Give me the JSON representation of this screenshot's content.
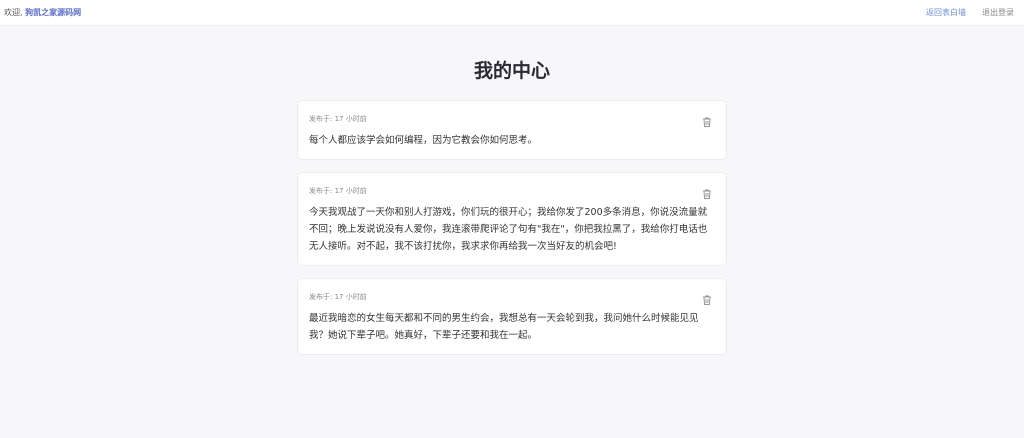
{
  "header": {
    "welcome_prefix": "欢迎,",
    "username": "狗凯之家源码网",
    "back_link": "返回表白墙",
    "logout_link": "退出登录"
  },
  "page_title": "我的中心",
  "posts": [
    {
      "meta": "发布于: 17 小时前",
      "content": "每个人都应该学会如何编程，因为它教会你如何思考。"
    },
    {
      "meta": "发布于: 17 小时前",
      "content": "今天我观战了一天你和别人打游戏，你们玩的很开心；我给你发了200多条消息，你说没流量就不回；晚上发说说没有人爱你，我连滚带爬评论了句有\"我在\"，你把我拉黑了，我给你打电话也无人接听。对不起，我不该打扰你，我求求你再给我一次当好友的机会吧!"
    },
    {
      "meta": "发布于: 17 小时前",
      "content": "最近我暗恋的女生每天都和不同的男生约会，我想总有一天会轮到我，我问她什么时候能见见我？她说下辈子吧。她真好，下辈子还要和我在一起。"
    }
  ],
  "icons": {
    "delete": "trash-icon"
  },
  "colors": {
    "accent": "#5b6cc9",
    "link": "#6f8fd8",
    "background": "#f7f7f9"
  }
}
